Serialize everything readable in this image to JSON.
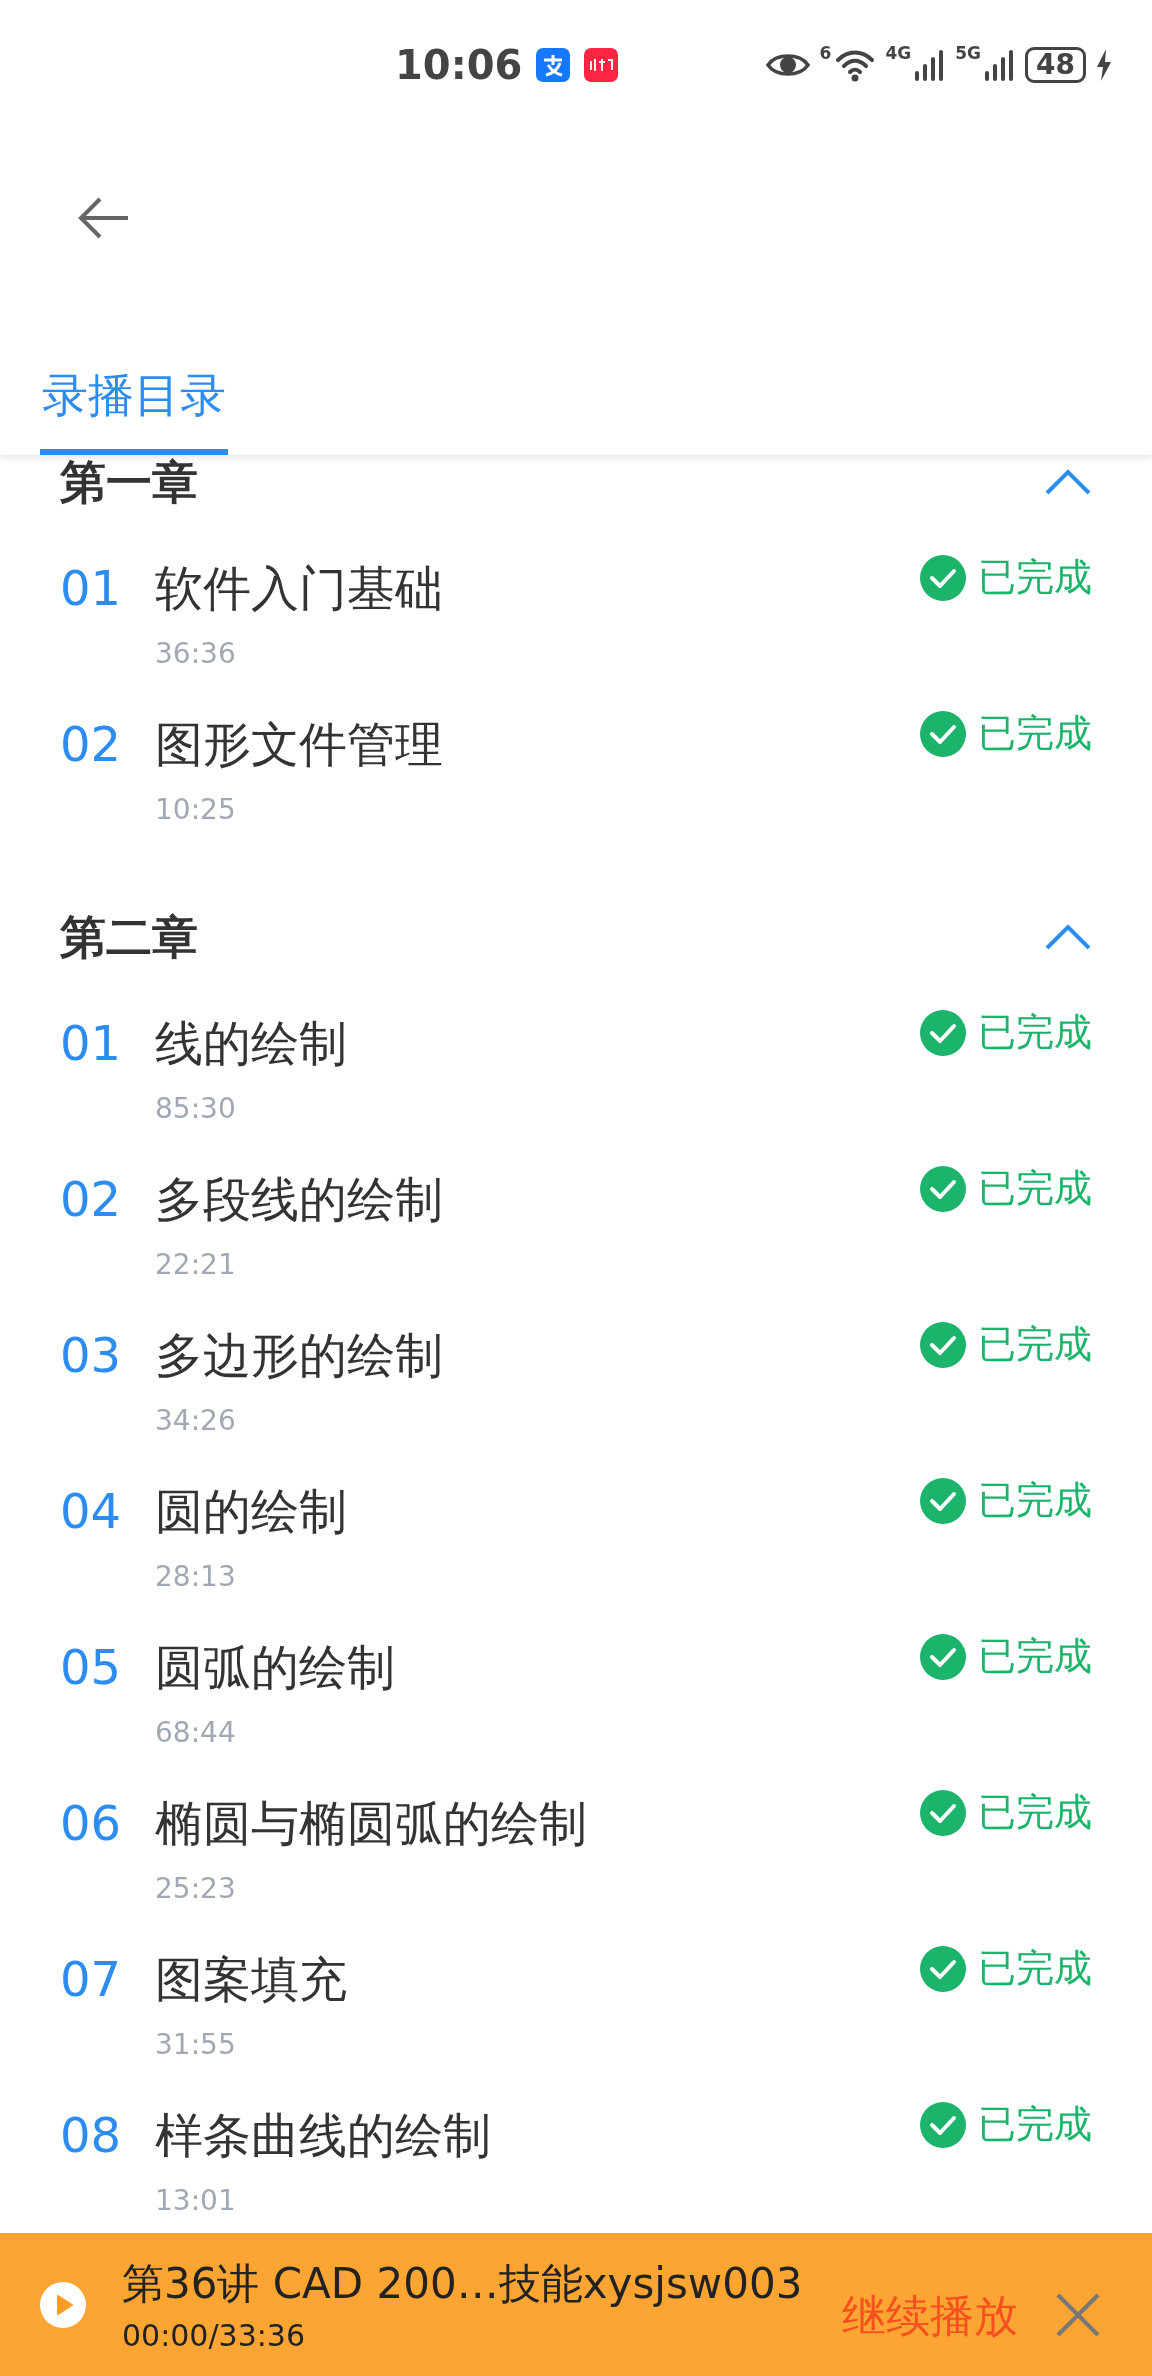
{
  "status_bar": {
    "time": "10:06",
    "wifi_label": "6",
    "network_labels": [
      "4G",
      "5G"
    ],
    "battery": "48"
  },
  "tabs": [
    {
      "label": "录播目录",
      "selected": true
    }
  ],
  "chapters": [
    {
      "title": "第一章",
      "expanded": true,
      "lessons": [
        {
          "number": "01",
          "title": "软件入门基础",
          "duration": "36:36",
          "status": "已完成",
          "done": true
        },
        {
          "number": "02",
          "title": "图形文件管理",
          "duration": "10:25",
          "status": "已完成",
          "done": true
        }
      ]
    },
    {
      "title": "第二章",
      "expanded": true,
      "lessons": [
        {
          "number": "01",
          "title": "线的绘制",
          "duration": "85:30",
          "status": "已完成",
          "done": true
        },
        {
          "number": "02",
          "title": "多段线的绘制",
          "duration": "22:21",
          "status": "已完成",
          "done": true
        },
        {
          "number": "03",
          "title": "多边形的绘制",
          "duration": "34:26",
          "status": "已完成",
          "done": true
        },
        {
          "number": "04",
          "title": "圆的绘制",
          "duration": "28:13",
          "status": "已完成",
          "done": true
        },
        {
          "number": "05",
          "title": "圆弧的绘制",
          "duration": "68:44",
          "status": "已完成",
          "done": true
        },
        {
          "number": "06",
          "title": "椭圆与椭圆弧的绘制",
          "duration": "25:23",
          "status": "已完成",
          "done": true
        },
        {
          "number": "07",
          "title": "图案填充",
          "duration": "31:55",
          "status": "已完成",
          "done": true
        },
        {
          "number": "08",
          "title": "样条曲线的绘制",
          "duration": "13:01",
          "status": "已完成",
          "done": true
        }
      ]
    }
  ],
  "player": {
    "title": "第36讲 CAD 200…技能xysjsw003",
    "time": "00:00/33:36",
    "action": "继续播放"
  }
}
